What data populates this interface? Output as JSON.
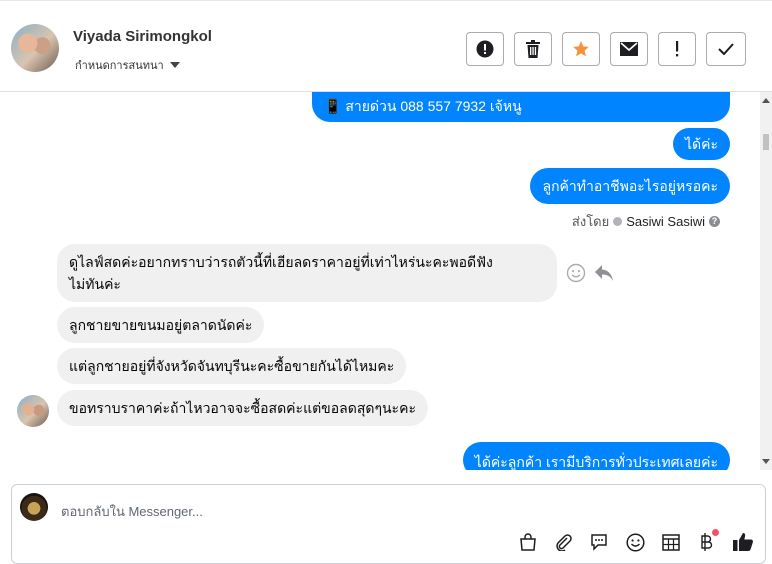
{
  "header": {
    "contact_name": "Viyada Sirimongkol",
    "subtitle": "กำหนดการสนทนา",
    "buttons": [
      {
        "name": "spam",
        "icon": "exclamation-circle-icon"
      },
      {
        "name": "delete",
        "icon": "trash-icon"
      },
      {
        "name": "star",
        "icon": "star-icon",
        "color": "#f7923a"
      },
      {
        "name": "mark-unread",
        "icon": "envelope-icon"
      },
      {
        "name": "follow-up",
        "icon": "exclamation-icon"
      },
      {
        "name": "done",
        "icon": "checkmark-icon"
      }
    ]
  },
  "messages": {
    "outgoing_top": [
      {
        "text": "📱 สายด่วน 088 557 7932 เจ้หนู"
      },
      {
        "text": "ได้ค่ะ"
      },
      {
        "text": "ลูกค้าทำอาชีพอะไรอยู่หรอคะ"
      }
    ],
    "sent_by": {
      "label": "ส่งโดย",
      "agent": "Sasiwi Sasiwi",
      "help_glyph": "?"
    },
    "incoming": [
      {
        "line1": "ดูไลฟ์สดค่ะอยากทราบว่ารถตัวนี้ที่เฮียลดราคาอยู่ที่เท่าไหร่นะคะพอดีฟัง",
        "line2": "ไม่ทันค่ะ"
      },
      {
        "text": "ลูกชายขายขนมอยู่ตลาดนัดค่ะ"
      },
      {
        "text": "แต่ลูกชายอยู่ที่จังหวัดจันทบุรีนะคะซื้อขายกันได้ไหมคะ"
      },
      {
        "text": "ขอทราบราคาค่ะถ้าไหวอาจจะซื้อสดค่ะแต่ขอลดสุดๆนะคะ"
      }
    ],
    "outgoing_bottom": {
      "text": "ได้ค่ะลูกค้า เรามีบริการทั่วประเทศเลยค่ะ"
    }
  },
  "composer": {
    "placeholder": "ตอบกลับใน Messenger...",
    "tools": [
      "shopping-bag-icon",
      "paperclip-icon",
      "saved-replies-icon",
      "emoji-icon",
      "appointment-icon",
      "baht-payment-icon",
      "thumbs-up-icon"
    ],
    "accent": "#0084ff",
    "notification_color": "#f25268"
  }
}
